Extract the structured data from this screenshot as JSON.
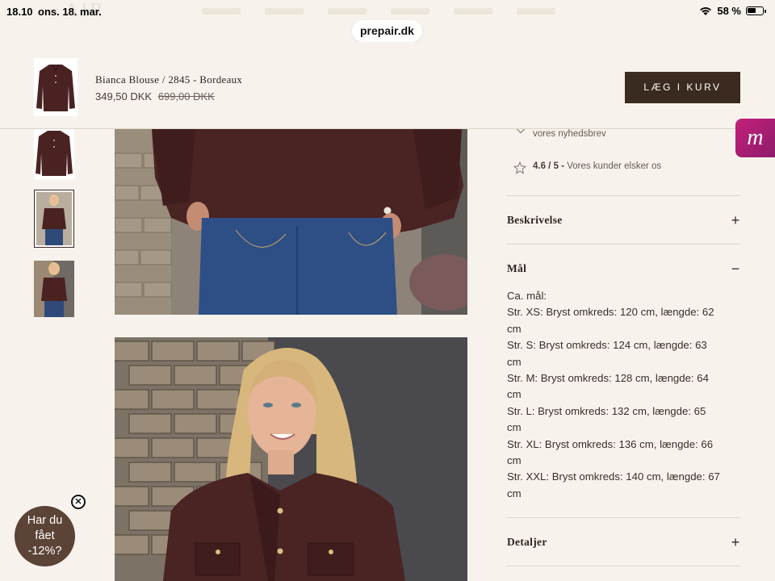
{
  "status_bar": {
    "time": "18.10",
    "date": "ons. 18. mar.",
    "battery": "58 %",
    "battery_level": 0.58
  },
  "browser": {
    "url": "prepair.dk"
  },
  "sticky_header": {
    "product_title": "Bianca Blouse / 2845 - Bordeaux",
    "price": "349,50 DKK",
    "old_price": "699,00 DKK",
    "cart_button": "LÆG I KURV"
  },
  "perks": [
    {
      "icon": "tag-icon",
      "text": "vores nyhedsbrev"
    },
    {
      "icon": "star-icon",
      "rating": "4.6 / 5 -",
      "text": "Vores kunder elsker os"
    }
  ],
  "accordion": [
    {
      "title": "Beskrivelse",
      "expanded": false,
      "toggle": "+"
    },
    {
      "title": "Mål",
      "expanded": true,
      "toggle": "−"
    },
    {
      "title": "Detaljer",
      "expanded": false,
      "toggle": "+"
    }
  ],
  "measurements": [
    "Ca. mål:",
    "Str. XS: Bryst omkreds: 120 cm, længde: 62",
    "cm",
    "Str. S: Bryst omkreds: 124 cm, længde: 63",
    "cm",
    "Str. M: Bryst omkreds: 128 cm, længde: 64",
    "cm",
    "Str. L: Bryst omkreds: 132 cm, længde: 65",
    "cm",
    "Str. XL: Bryst omkreds: 136 cm, længde: 66",
    "cm",
    "Str. XXL: Bryst omkreds: 140 cm, længde: 67",
    "cm"
  ],
  "badge": {
    "letter": "m"
  },
  "discount_popup": {
    "line1": "Har du",
    "line2": "fået",
    "line3": "-12%?",
    "close": "✕"
  },
  "colors": {
    "bordeaux": "#4a2222",
    "brown_button": "#3b2a1f",
    "cream_bg": "#f7f3ec",
    "magenta": "#c4207a"
  }
}
